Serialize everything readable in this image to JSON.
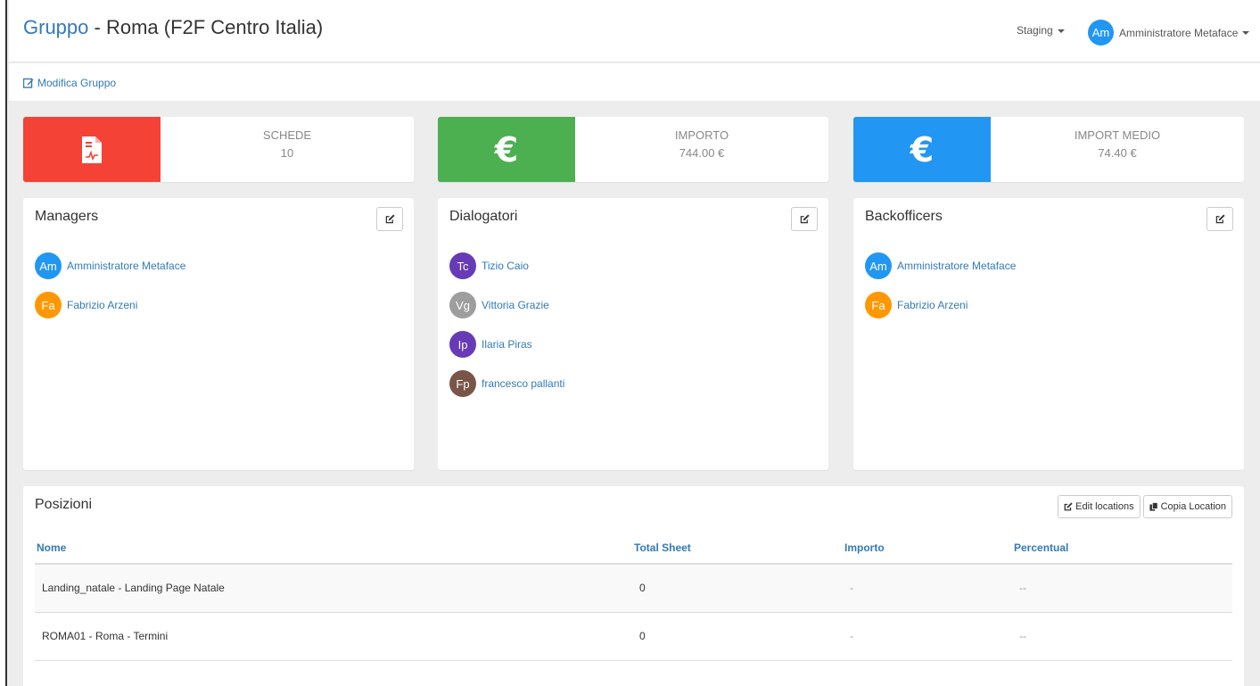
{
  "header": {
    "title_link": "Gruppo",
    "title_rest": " - Roma (F2F Centro Italia)",
    "env_label": "Staging",
    "user": {
      "initials": "Am",
      "name": "Amministratore Metaface",
      "color": "#2196f3"
    }
  },
  "subbar": {
    "edit_label": "Modifica Gruppo"
  },
  "stats": [
    {
      "label": "SCHEDE",
      "value": "10",
      "color": "#f44336",
      "icon": "file-pdf-icon"
    },
    {
      "label": "IMPORTO",
      "value": "744.00 €",
      "color": "#4caf50",
      "icon": "euro-icon"
    },
    {
      "label": "IMPORT MEDIO",
      "value": "74.40 €",
      "color": "#2196f3",
      "icon": "euro-icon"
    }
  ],
  "panels": {
    "managers": {
      "title": "Managers",
      "members": [
        {
          "initials": "Am",
          "name": "Amministratore Metaface",
          "color": "#2196f3"
        },
        {
          "initials": "Fa",
          "name": "Fabrizio Arzeni",
          "color": "#ff9800"
        }
      ]
    },
    "dialogatori": {
      "title": "Dialogatori",
      "members": [
        {
          "initials": "Tc",
          "name": "Tizio Caio",
          "color": "#673ab7"
        },
        {
          "initials": "Vg",
          "name": "Vittoria Grazie",
          "color": "#9e9e9e"
        },
        {
          "initials": "Ip",
          "name": "Ilaria Piras",
          "color": "#673ab7"
        },
        {
          "initials": "Fp",
          "name": "francesco pallanti",
          "color": "#795548"
        }
      ]
    },
    "backofficers": {
      "title": "Backofficers",
      "members": [
        {
          "initials": "Am",
          "name": "Amministratore Metaface",
          "color": "#2196f3"
        },
        {
          "initials": "Fa",
          "name": "Fabrizio Arzeni",
          "color": "#ff9800"
        }
      ]
    }
  },
  "positions": {
    "title": "Posizioni",
    "edit_locations": "Edit locations",
    "copy_location": "Copia Location",
    "columns": [
      "Nome",
      "Total Sheet",
      "Importo",
      "Percentual"
    ],
    "rows": [
      [
        "Landing_natale - Landing Page Natale",
        "0",
        "-",
        "--"
      ],
      [
        "ROMA01 - Roma - Termini",
        "0",
        "-",
        "--"
      ]
    ]
  }
}
